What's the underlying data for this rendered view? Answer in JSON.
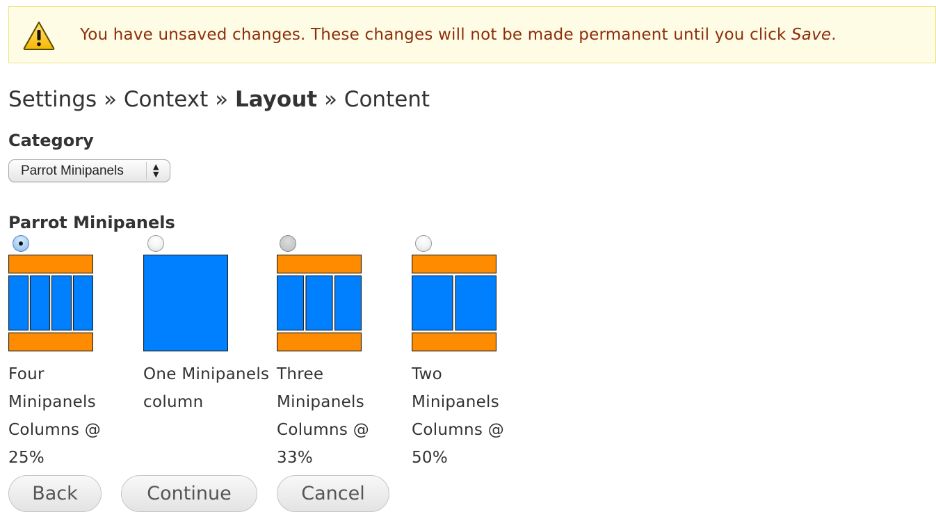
{
  "warning": {
    "text": "You have unsaved changes. These changes will not be made permanent until you click ",
    "emphasis": "Save",
    "suffix": ".",
    "icon": "warning-triangle-icon"
  },
  "breadcrumb": {
    "items": [
      "Settings",
      "Context",
      "Layout",
      "Content"
    ],
    "separator": "»",
    "current_index": 2
  },
  "category": {
    "label": "Category",
    "selected": "Parrot Minipanels"
  },
  "layouts": {
    "group_label": "Parrot Minipanels",
    "options": [
      {
        "title": "Four Minipanels Columns @ 25%",
        "checked": true
      },
      {
        "title": "One Minipanels column",
        "checked": false
      },
      {
        "title": "Three Minipanels Columns @ 33%",
        "checked": false
      },
      {
        "title": "Two Minipanels Columns @ 50%",
        "checked": false
      }
    ]
  },
  "buttons": {
    "back": "Back",
    "continue": "Continue",
    "cancel": "Cancel"
  },
  "colors": {
    "warning_bg": "#fffce5",
    "warning_border": "#ede383",
    "warning_text": "#8c2e0b",
    "panel_blue": "#0080ff",
    "panel_orange": "#ff8c00"
  }
}
